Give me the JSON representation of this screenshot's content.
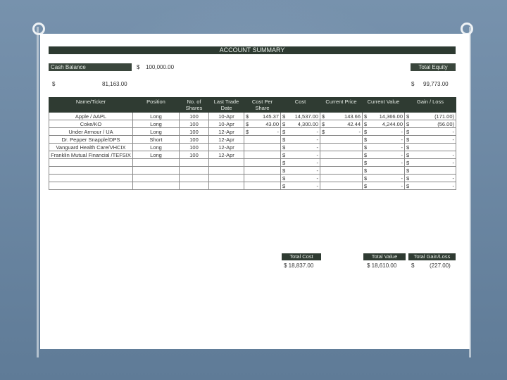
{
  "title": "ACCOUNT SUMMARY",
  "cash_balance_label": "Cash Balance",
  "cash_balance_currency": "$",
  "cash_balance_value": "100,000.00",
  "total_equity_label": "Total Equity",
  "cash_remaining_currency": "$",
  "cash_remaining_value": "81,163.00",
  "total_equity_currency": "$",
  "total_equity_value": "99,773.00",
  "headers": {
    "name": "Name/Ticker",
    "position": "Position",
    "shares": "No. of Shares",
    "trade_date": "Last Trade Date",
    "cost_per_share": "Cost Per Share",
    "cost": "Cost",
    "current_price": "Current Price",
    "current_value": "Current Value",
    "gain_loss": "Gain / Loss"
  },
  "rows": [
    {
      "name": "Apple / AAPL",
      "position": "Long",
      "shares": "100",
      "date": "10-Apr",
      "cps_cur": "$",
      "cps": "145.37",
      "cost_cur": "$",
      "cost": "14,537.00",
      "cp_cur": "$",
      "cp": "143.66",
      "cv_cur": "$",
      "cv": "14,366.00",
      "gl_cur": "$",
      "gl": "(171.00)"
    },
    {
      "name": "Coke/KO",
      "position": "Long",
      "shares": "100",
      "date": "10-Apr",
      "cps_cur": "$",
      "cps": "43.00",
      "cost_cur": "$",
      "cost": "4,300.00",
      "cp_cur": "$",
      "cp": "42.44",
      "cv_cur": "$",
      "cv": "4,244.00",
      "gl_cur": "$",
      "gl": "(56.00)"
    },
    {
      "name": "Under Armour / UA",
      "position": "Long",
      "shares": "100",
      "date": "12-Apr",
      "cps_cur": "$",
      "cps": "-",
      "cost_cur": "$",
      "cost": "-",
      "cp_cur": "$",
      "cp": "-",
      "cv_cur": "$",
      "cv": "-",
      "gl_cur": "$",
      "gl": "-"
    },
    {
      "name": "Dr. Pepper Snapple/DPS",
      "position": "Short",
      "shares": "100",
      "date": "12-Apr",
      "cps_cur": "",
      "cps": "",
      "cost_cur": "$",
      "cost": "-",
      "cp_cur": "",
      "cp": "",
      "cv_cur": "$",
      "cv": "-",
      "gl_cur": "$",
      "gl": "-"
    },
    {
      "name": "Vanguard Health Care/VHCIX",
      "position": "Long",
      "shares": "100",
      "date": "12-Apr",
      "cps_cur": "",
      "cps": "",
      "cost_cur": "$",
      "cost": "-",
      "cp_cur": "",
      "cp": "",
      "cv_cur": "$",
      "cv": "-",
      "gl_cur": "$",
      "gl": ""
    },
    {
      "name": "Franklin Mutual Financial /TEFSIX",
      "position": "Long",
      "shares": "100",
      "date": "12-Apr",
      "cps_cur": "",
      "cps": "",
      "cost_cur": "$",
      "cost": "-",
      "cp_cur": "",
      "cp": "",
      "cv_cur": "$",
      "cv": "-",
      "gl_cur": "$",
      "gl": "-"
    },
    {
      "name": "",
      "position": "",
      "shares": "",
      "date": "",
      "cps_cur": "",
      "cps": "",
      "cost_cur": "$",
      "cost": "-",
      "cp_cur": "",
      "cp": "",
      "cv_cur": "$",
      "cv": "-",
      "gl_cur": "$",
      "gl": "-"
    },
    {
      "name": "",
      "position": "",
      "shares": "",
      "date": "",
      "cps_cur": "",
      "cps": "",
      "cost_cur": "$",
      "cost": "-",
      "cp_cur": "",
      "cp": "",
      "cv_cur": "$",
      "cv": "",
      "gl_cur": "$",
      "gl": ""
    },
    {
      "name": "",
      "position": "",
      "shares": "",
      "date": "",
      "cps_cur": "",
      "cps": "",
      "cost_cur": "$",
      "cost": "-",
      "cp_cur": "",
      "cp": "",
      "cv_cur": "$",
      "cv": "-",
      "gl_cur": "$",
      "gl": "-"
    },
    {
      "name": "",
      "position": "",
      "shares": "",
      "date": "",
      "cps_cur": "",
      "cps": "",
      "cost_cur": "$",
      "cost": "-",
      "cp_cur": "",
      "cp": "",
      "cv_cur": "$",
      "cv": "-",
      "gl_cur": "$",
      "gl": "-"
    }
  ],
  "totals": {
    "total_cost_label": "Total Cost",
    "total_cost_value": "$ 18,837.00",
    "total_value_label": "Total Value",
    "total_value_value": "$ 18,610.00",
    "total_gain_label": "Total Gain/Loss",
    "total_gain_currency": "$",
    "total_gain_value": "(227.00)"
  }
}
